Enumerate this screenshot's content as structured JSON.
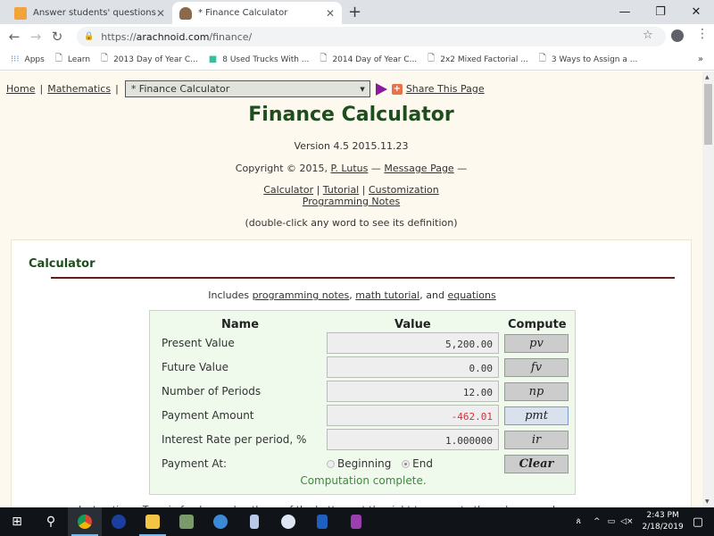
{
  "browser": {
    "tabs": [
      {
        "label": "Answer students' questions and |",
        "active": false
      },
      {
        "label": "* Finance Calculator",
        "active": true
      }
    ],
    "new_tab": "+",
    "window_controls": {
      "minimize": "—",
      "restore": "❐",
      "close": "✕"
    },
    "url": {
      "scheme": "https://",
      "host": "arachnoid.com",
      "path": "/finance/"
    },
    "bookmarks": [
      "Apps",
      "Learn",
      "2013 Day of Year C...",
      "8 Used Trucks With ...",
      "2014 Day of Year C...",
      "2x2 Mixed Factorial ...",
      "3 Ways to Assign a ..."
    ],
    "bookmarks_more": "»"
  },
  "page": {
    "breadcrumb": {
      "home": "Home",
      "mathematics": "Mathematics",
      "select_value": "* Finance Calculator",
      "share": "Share This Page"
    },
    "title": "Finance Calculator",
    "version": "Version 4.5 2015.11.23",
    "copyright": {
      "prefix": "Copyright © 2015,",
      "author": "P. Lutus",
      "dash1": "—",
      "message": "Message Page",
      "dash2": "—"
    },
    "links": {
      "calculator": "Calculator",
      "tutorial": "Tutorial",
      "customization": "Customization",
      "programming": "Programming Notes"
    },
    "hint": "(double-click any word to see its definition)",
    "section_title": "Calculator",
    "includes": {
      "prefix": "Includes",
      "programming": "programming notes",
      "math": "math tutorial",
      "and": ", and",
      "equations": "equations"
    },
    "calc": {
      "headers": {
        "name": "Name",
        "value": "Value",
        "compute": "Compute"
      },
      "rows": [
        {
          "label": "Present Value",
          "value": "5,200.00",
          "button": "pv"
        },
        {
          "label": "Future Value",
          "value": "0.00",
          "button": "fv"
        },
        {
          "label": "Number of Periods",
          "value": "12.00",
          "button": "np"
        },
        {
          "label": "Payment Amount",
          "value": "-462.01",
          "button": "pmt"
        },
        {
          "label": "Interest Rate per period, %",
          "value": "1.000000",
          "button": "ir"
        }
      ],
      "payment_at": {
        "label": "Payment At:",
        "options": [
          "Beginning",
          "End"
        ],
        "selected": "End"
      },
      "clear": "Clear",
      "status": "Computation complete."
    },
    "instructions_partial": "Instructions: Type in food ... and ... the ... of the buttons at the right to compute the unknown value"
  },
  "taskbar": {
    "time": "2:43 PM",
    "date": "2/18/2019"
  }
}
